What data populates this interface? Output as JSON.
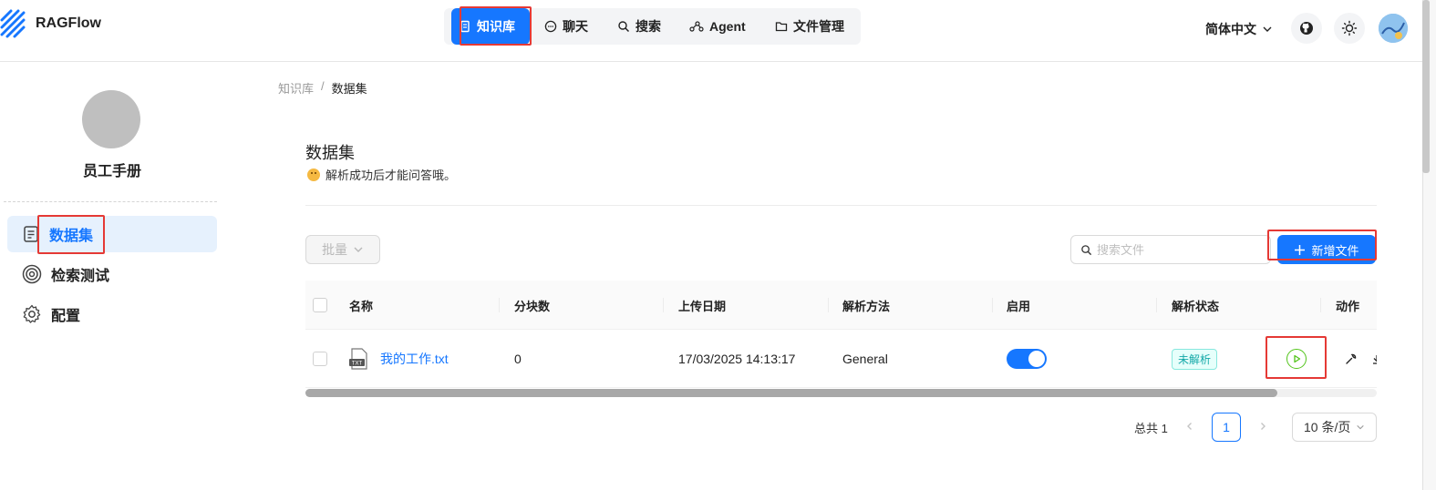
{
  "header": {
    "app_title": "RAGFlow",
    "nav": [
      {
        "label": "知识库",
        "icon": "book-icon",
        "active": true
      },
      {
        "label": "聊天",
        "icon": "chat-bubble-icon",
        "active": false
      },
      {
        "label": "搜索",
        "icon": "search-icon",
        "active": false
      },
      {
        "label": "Agent",
        "icon": "agent-graph-icon",
        "active": false
      },
      {
        "label": "文件管理",
        "icon": "folder-icon",
        "active": false
      }
    ],
    "language": "简体中文",
    "github_icon": "github-icon",
    "theme_icon": "sun-icon",
    "accent": "#1677ff"
  },
  "sidebar": {
    "kb_name": "员工手册",
    "items": [
      {
        "label": "数据集",
        "icon": "document-icon",
        "active": true
      },
      {
        "label": "检索测试",
        "icon": "target-icon",
        "active": false
      },
      {
        "label": "配置",
        "icon": "gear-icon",
        "active": false
      }
    ]
  },
  "main": {
    "breadcrumb": [
      "知识库",
      "数据集"
    ],
    "breadcrumb_sep": "/",
    "title": "数据集",
    "tip": "解析成功后才能问答哦。",
    "bulk_label": "批量",
    "search_placeholder": "搜索文件",
    "add_label": "新增文件",
    "table": {
      "columns": [
        "名称",
        "分块数",
        "上传日期",
        "解析方法",
        "启用",
        "解析状态",
        "动作"
      ],
      "rows": [
        {
          "name": "我的工作.txt",
          "file_type": "TXT",
          "chunks": "0",
          "upload_date": "17/03/2025 14:13:17",
          "parser": "General",
          "enabled": true,
          "status": "未解析"
        }
      ],
      "scroll_fraction": 0.907
    },
    "pagination": {
      "total_label": "总共 1",
      "current_page": "1",
      "page_size": "10 条/页"
    }
  }
}
